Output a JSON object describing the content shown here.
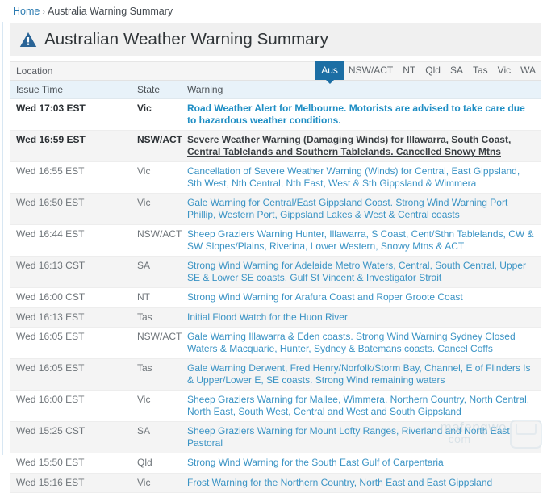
{
  "breadcrumb": {
    "home_label": "Home",
    "separator": "›",
    "current_label": "Australia Warning Summary"
  },
  "banner": {
    "icon": "warning-triangle-icon",
    "title": "Australian Weather Warning Summary",
    "icon_color": "#2a6496"
  },
  "locationbar": {
    "label": "Location",
    "active_tab": "Aus",
    "tabs": [
      {
        "label": "Aus",
        "active": true
      },
      {
        "label": "NSW/ACT",
        "active": false
      },
      {
        "label": "NT",
        "active": false
      },
      {
        "label": "Qld",
        "active": false
      },
      {
        "label": "SA",
        "active": false
      },
      {
        "label": "Tas",
        "active": false
      },
      {
        "label": "Vic",
        "active": false
      },
      {
        "label": "WA",
        "active": false
      }
    ],
    "active_color": "#1c6ea4"
  },
  "table": {
    "columns": [
      "Issue Time",
      "State",
      "Warning"
    ],
    "rows": [
      {
        "time": "Wed 17:03 EST",
        "state": "Vic",
        "warning": "Road Weather Alert for Melbourne. Motorists are advised to take care due to hazardous weather conditions.",
        "style": "hot"
      },
      {
        "time": "Wed 16:59 EST",
        "state": "NSW/ACT",
        "warning": "Severe Weather Warning (Damaging Winds) for Illawarra, South Coast, Central Tablelands and Southern Tablelands. Cancelled Snowy Mtns",
        "style": "hovered"
      },
      {
        "time": "Wed 16:55 EST",
        "state": "Vic",
        "warning": "Cancellation of Severe Weather Warning (Winds) for Central, East Gippsland, Sth West, Nth Central, Nth East, West & Sth Gippsland & Wimmera",
        "style": "normal"
      },
      {
        "time": "Wed 16:50 EST",
        "state": "Vic",
        "warning": "Gale Warning for Central/East Gippsland Coast. Strong Wind Warning Port Phillip, Western Port, Gippsland Lakes & West & Central coasts",
        "style": "normal"
      },
      {
        "time": "Wed 16:44 EST",
        "state": "NSW/ACT",
        "warning": "Sheep Graziers Warning Hunter, Illawarra, S Coast, Cent/Sthn Tablelands, CW & SW Slopes/Plains, Riverina, Lower Western, Snowy Mtns & ACT",
        "style": "normal"
      },
      {
        "time": "Wed 16:13 CST",
        "state": "SA",
        "warning": "Strong Wind Warning for Adelaide Metro Waters, Central, South Central, Upper SE & Lower SE coasts, Gulf St Vincent & Investigator Strait",
        "style": "normal"
      },
      {
        "time": "Wed 16:00 CST",
        "state": "NT",
        "warning": "Strong Wind Warning for Arafura Coast and Roper Groote Coast",
        "style": "normal"
      },
      {
        "time": "Wed 16:13 EST",
        "state": "Tas",
        "warning": "Initial Flood Watch for the Huon River",
        "style": "normal"
      },
      {
        "time": "Wed 16:05 EST",
        "state": "NSW/ACT",
        "warning": "Gale Warning Illawarra & Eden coasts. Strong Wind Warning Sydney Closed Waters & Macquarie, Hunter, Sydney & Batemans coasts. Cancel Coffs",
        "style": "normal"
      },
      {
        "time": "Wed 16:05 EST",
        "state": "Tas",
        "warning": "Gale Warning Derwent, Fred Henry/Norfolk/Storm Bay, Channel, E of Flinders Is & Upper/Lower E, SE coasts. Strong Wind remaining waters",
        "style": "normal"
      },
      {
        "time": "Wed 16:00 EST",
        "state": "Vic",
        "warning": "Sheep Graziers Warning for Mallee, Wimmera, Northern Country, North Central, North East, South West, Central and West and South Gippsland",
        "style": "normal"
      },
      {
        "time": "Wed 15:25 CST",
        "state": "SA",
        "warning": "Sheep Graziers Warning for Mount Lofty Ranges, Riverland and North East Pastoral",
        "style": "normal"
      },
      {
        "time": "Wed 15:50 EST",
        "state": "Qld",
        "warning": "Strong Wind Warning for the South East Gulf of Carpentaria",
        "style": "normal"
      },
      {
        "time": "Wed 15:16 EST",
        "state": "Vic",
        "warning": "Frost Warning for the Northern Country, North East and East Gippsland",
        "style": "normal"
      }
    ]
  },
  "watermark": {
    "name": "mafengwo",
    "domain": "com",
    "logo": "envelope-logo-icon"
  }
}
